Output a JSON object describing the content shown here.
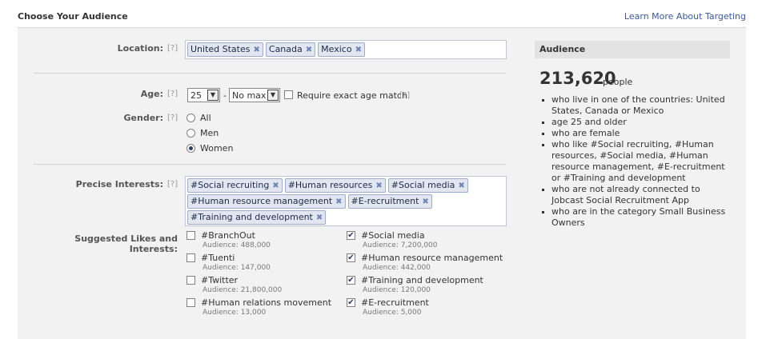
{
  "header": {
    "title": "Choose Your Audience",
    "learn_link": "Learn More About Targeting"
  },
  "help_mark": "[?]",
  "location": {
    "label": "Location:",
    "tokens": [
      "United States",
      "Canada",
      "Mexico"
    ]
  },
  "age": {
    "label": "Age:",
    "min": "25",
    "separator": "-",
    "max": "No max",
    "exact_label": "Require exact age match"
  },
  "gender": {
    "label": "Gender:",
    "options": [
      "All",
      "Men",
      "Women"
    ],
    "selected": "Women"
  },
  "interests": {
    "label": "Precise Interests:",
    "tokens": [
      "#Social recruiting",
      "#Human resources",
      "#Social media",
      "#Human resource management",
      "#E-recruitment",
      "#Training and development"
    ]
  },
  "suggested": {
    "label": "Suggested Likes and Interests:",
    "left": [
      {
        "name": "#BranchOut",
        "audience": "Audience: 488,000",
        "checked": false
      },
      {
        "name": "#Tuenti",
        "audience": "Audience: 147,000",
        "checked": false
      },
      {
        "name": "#Twitter",
        "audience": "Audience: 21,800,000",
        "checked": false
      },
      {
        "name": "#Human relations movement",
        "audience": "Audience: 13,000",
        "checked": false
      }
    ],
    "right": [
      {
        "name": "#Social media",
        "audience": "Audience: 7,200,000",
        "checked": true
      },
      {
        "name": "#Human resource management",
        "audience": "Audience: 442,000",
        "checked": true
      },
      {
        "name": "#Training and development",
        "audience": "Audience: 120,000",
        "checked": true
      },
      {
        "name": "#E-recruitment",
        "audience": "Audience: 5,000",
        "checked": true
      }
    ]
  },
  "audience": {
    "heading": "Audience",
    "count": "213,620",
    "unit": "people",
    "bullets": [
      "who live in one of the countries: United States, Canada or Mexico",
      "age 25 and older",
      "who are female",
      "who like #Social recruiting, #Human resources, #Social media, #Human resource management, #E-recruitment or #Training and development",
      "who are not already connected to Jobcast Social Recruitment App",
      "who are in the category Small Business Owners"
    ]
  },
  "icons": {
    "remove": "x-icon",
    "dropdown": "chevron-down-icon",
    "check": "checkmark-icon"
  },
  "colors": {
    "link": "#3b5998",
    "token_bg": "#e2e6f0",
    "token_border": "#9daccc",
    "panel_bg": "#f2f2f2"
  }
}
